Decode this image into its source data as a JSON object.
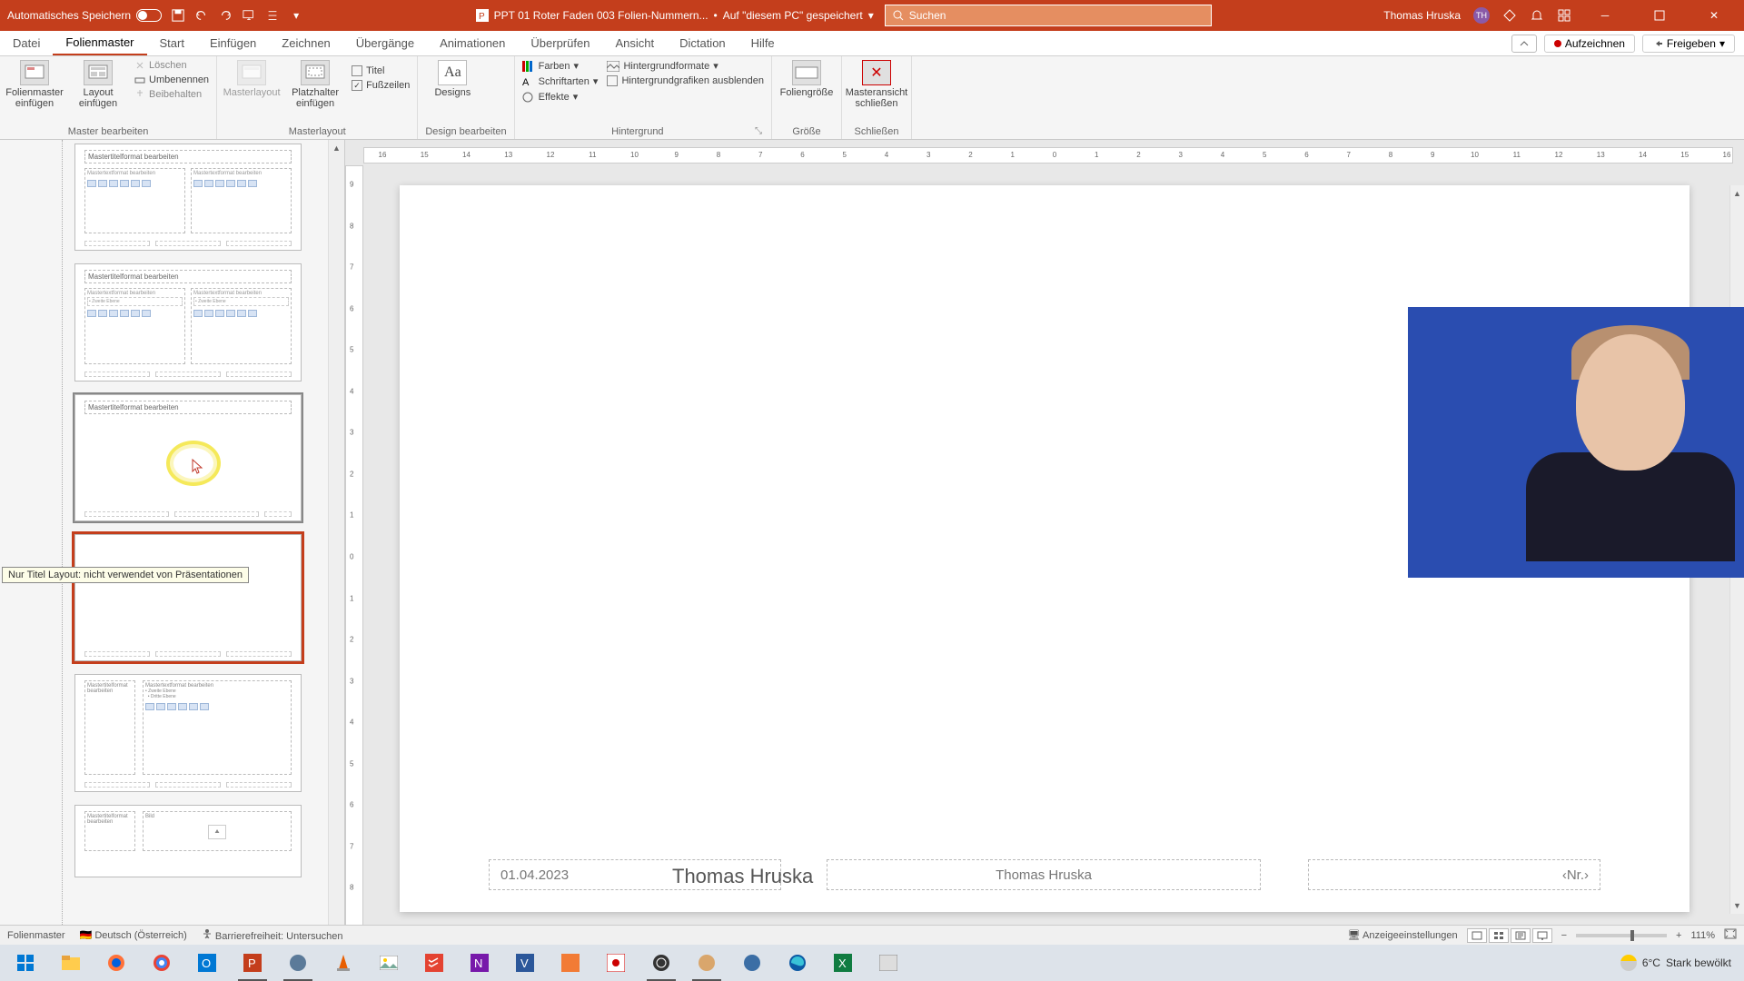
{
  "titlebar": {
    "autosave_label": "Automatisches Speichern",
    "doc_name": "PPT 01 Roter Faden 003 Folien-Nummern...",
    "save_location_prefix": "Auf \"diesem PC\" gespeichert",
    "search_placeholder": "Suchen",
    "user_name": "Thomas Hruska",
    "user_initials": "TH"
  },
  "tabs": {
    "datei": "Datei",
    "folienmaster": "Folienmaster",
    "start": "Start",
    "einfuegen": "Einfügen",
    "zeichnen": "Zeichnen",
    "uebergaenge": "Übergänge",
    "animationen": "Animationen",
    "ueberpruefen": "Überprüfen",
    "ansicht": "Ansicht",
    "dictation": "Dictation",
    "hilfe": "Hilfe",
    "aufzeichnen": "Aufzeichnen",
    "freigeben": "Freigeben"
  },
  "ribbon": {
    "group_master_bearbeiten": "Master bearbeiten",
    "folienmaster_einfuegen": "Folienmaster einfügen",
    "layout_einfuegen": "Layout einfügen",
    "loeschen": "Löschen",
    "umbenennen": "Umbenennen",
    "beibehalten": "Beibehalten",
    "group_masterlayout": "Masterlayout",
    "masterlayout": "Masterlayout",
    "platzhalter_einfuegen": "Platzhalter einfügen",
    "titel": "Titel",
    "fusszeilen": "Fußzeilen",
    "group_design_bearbeiten": "Design bearbeiten",
    "designs": "Designs",
    "farben": "Farben",
    "schriftarten": "Schriftarten",
    "effekte": "Effekte",
    "group_hintergrund": "Hintergrund",
    "hintergrundformate": "Hintergrundformate",
    "hintergrundgrafiken_ausblenden": "Hintergrundgrafiken ausblenden",
    "group_groesse": "Größe",
    "foliengroesse": "Foliengröße",
    "group_schliessen": "Schließen",
    "masteransicht_schliessen": "Masteransicht schließen"
  },
  "ruler": {
    "labels": [
      "16",
      "15",
      "14",
      "13",
      "12",
      "11",
      "10",
      "9",
      "8",
      "7",
      "6",
      "5",
      "4",
      "3",
      "2",
      "1",
      "0",
      "1",
      "2",
      "3",
      "4",
      "5",
      "6",
      "7",
      "8",
      "9",
      "10",
      "11",
      "12",
      "13",
      "14",
      "15",
      "16"
    ]
  },
  "vruler": {
    "labels": [
      "9",
      "8",
      "7",
      "6",
      "5",
      "4",
      "3",
      "2",
      "1",
      "0",
      "1",
      "2",
      "3",
      "4",
      "5",
      "6",
      "7",
      "8",
      "9"
    ]
  },
  "thumbnails": {
    "placeholder_title_text": "Mastertitelformat bearbeiten",
    "content_placeholder_text": "Mastertextformat bearbeiten",
    "tooltip": "Nur Titel Layout: nicht verwendet von Präsentationen"
  },
  "slide": {
    "date_value": "01.04.2023",
    "header_author": "Thomas Hruska",
    "footer_author": "Thomas Hruska",
    "slide_number": "‹Nr.›"
  },
  "statusbar": {
    "view_label": "Folienmaster",
    "language": "Deutsch (Österreich)",
    "accessibility": "Barrierefreiheit: Untersuchen",
    "display_settings": "Anzeigeeinstellungen",
    "zoom_value": "111%"
  },
  "taskbar": {
    "weather_temp": "6°C",
    "weather_text": "Stark bewölkt"
  }
}
